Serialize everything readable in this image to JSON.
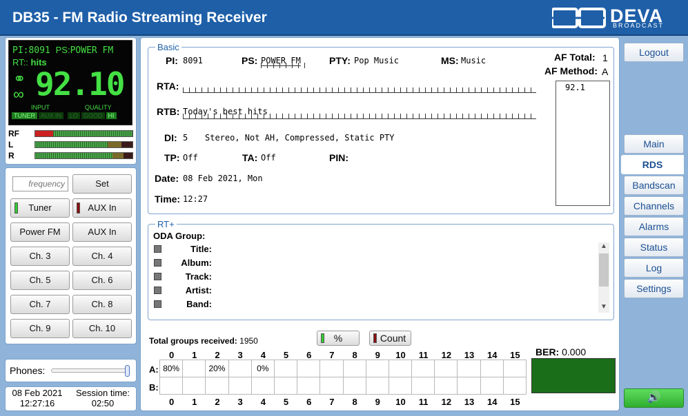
{
  "app": {
    "title": "DB35 - FM Radio Streaming Receiver",
    "logo_text": "DEVA",
    "logo_sub": "BROADCAST"
  },
  "lcd": {
    "pi_label": "PI:",
    "pi": "8091",
    "ps_label": "PS:",
    "ps": "POWER FM",
    "rt_label": "RT::",
    "rt": "hits",
    "frequency": "92.10",
    "input_label": "INPUT",
    "quality_label": "QUALITY",
    "input_opts": [
      "TUNER",
      "AUX IN"
    ],
    "quality_opts": [
      "LO",
      "GOOD",
      "HI"
    ]
  },
  "meters": {
    "rf": "RF",
    "l": "L",
    "r": "R"
  },
  "controls": {
    "frequency_placeholder": "frequency",
    "set": "Set",
    "tuner": "Tuner",
    "aux_in": "AUX In",
    "presets": [
      "Power FM",
      "AUX In",
      "Ch. 3",
      "Ch. 4",
      "Ch. 5",
      "Ch. 6",
      "Ch. 7",
      "Ch. 8",
      "Ch. 9",
      "Ch. 10"
    ]
  },
  "phones": {
    "label": "Phones:"
  },
  "session": {
    "date": "08 Feb 2021",
    "time": "12:27:16",
    "session_label": "Session time:",
    "session_time": "02:50"
  },
  "nav": {
    "logout": "Logout",
    "items": [
      "Main",
      "RDS",
      "Bandscan",
      "Channels",
      "Alarms",
      "Status",
      "Log",
      "Settings"
    ]
  },
  "basic": {
    "legend": "Basic",
    "pi_label": "PI:",
    "pi": "8091",
    "ps_label": "PS:",
    "ps": "POWER FM",
    "pty_label": "PTY:",
    "pty": "Pop Music",
    "ms_label": "MS:",
    "ms": "Music",
    "af_total_label": "AF Total:",
    "af_total": "1",
    "af_method_label": "AF Method:",
    "af_method": "A",
    "af_list": "92.1",
    "rta_label": "RTA:",
    "rta": "",
    "rtb_label": "RTB:",
    "rtb": "Today's best hits",
    "di_label": "DI:",
    "di": "5",
    "di_text": "Stereo, Not AH, Compressed, Static PTY",
    "tp_label": "TP:",
    "tp": "Off",
    "ta_label": "TA:",
    "ta": "Off",
    "pin_label": "PIN:",
    "pin": "",
    "date_label": "Date:",
    "date": "08 Feb 2021, Mon",
    "time_label": "Time:",
    "time": "12:27"
  },
  "rtplus": {
    "legend": "RT+",
    "oda_label": "ODA Group:",
    "fields": [
      "Title:",
      "Album:",
      "Track:",
      "Artist:",
      "Band:"
    ]
  },
  "groups": {
    "total_label": "Total groups received:",
    "total": "1950",
    "percent_btn": "%",
    "count_btn": "Count",
    "columns": [
      "0",
      "1",
      "2",
      "3",
      "4",
      "5",
      "6",
      "7",
      "8",
      "9",
      "10",
      "11",
      "12",
      "13",
      "14",
      "15"
    ],
    "row_a_label": "A:",
    "row_b_label": "B:",
    "row_a": [
      "80%",
      "",
      "20%",
      "",
      "0%",
      "",
      "",
      "",
      "",
      "",
      "",
      "",
      "",
      "",
      "",
      ""
    ],
    "row_b": [
      "",
      "",
      "",
      "",
      "",
      "",
      "",
      "",
      "",
      "",
      "",
      "",
      "",
      "",
      "",
      ""
    ],
    "ber_label": "BER:",
    "ber": "0.000"
  },
  "colors": {
    "header": "#1e5fa8",
    "lcd_text": "#44e044",
    "ber_box": "#1a6e1a",
    "speaker_btn": "#3fbf3f"
  }
}
